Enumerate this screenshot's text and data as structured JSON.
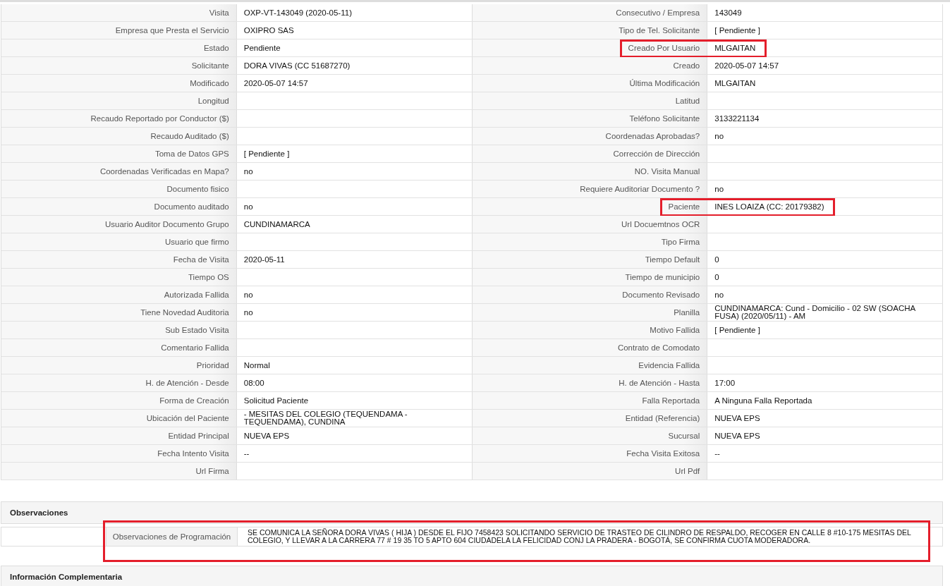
{
  "details": {
    "rows": [
      {
        "left": {
          "label": "Visita",
          "value": "OXP-VT-143049 (2020-05-11)",
          "highlighted": false
        },
        "right": {
          "label": "Consecutivo / Empresa",
          "value": "143049",
          "highlighted": false
        }
      },
      {
        "left": {
          "label": "Empresa que Presta el Servicio",
          "value": "OXIPRO SAS",
          "highlighted": false
        },
        "right": {
          "label": "Tipo de Tel. Solicitante",
          "value": "[ Pendiente ]",
          "highlighted": false
        }
      },
      {
        "left": {
          "label": "Estado",
          "value": "Pendiente",
          "highlighted": false
        },
        "right": {
          "label": "Creado Por Usuario",
          "value": "MLGAITAN",
          "highlighted": true
        }
      },
      {
        "left": {
          "label": "Solicitante",
          "value": "DORA VIVAS (CC 51687270)",
          "highlighted": false
        },
        "right": {
          "label": "Creado",
          "value": "2020-05-07 14:57",
          "highlighted": false
        }
      },
      {
        "left": {
          "label": "Modificado",
          "value": "2020-05-07 14:57",
          "highlighted": false
        },
        "right": {
          "label": "Última Modificación",
          "value": "MLGAITAN",
          "highlighted": false
        }
      },
      {
        "left": {
          "label": "Longitud",
          "highlighted": false
        },
        "right": {
          "label": "Latitud",
          "highlighted": false
        }
      },
      {
        "left": {
          "label": "Recaudo Reportado por Conductor ($)",
          "highlighted": false
        },
        "right": {
          "label": "Teléfono Solicitante",
          "value": "3133221134",
          "highlighted": false
        }
      },
      {
        "left": {
          "label": "Recaudo Auditado ($)",
          "highlighted": false
        },
        "right": {
          "label": "Coordenadas Aprobadas?",
          "value": "no",
          "highlighted": false
        }
      },
      {
        "left": {
          "label": "Toma de Datos GPS",
          "value": "[ Pendiente ]",
          "highlighted": false
        },
        "right": {
          "label": "Corrección de Dirección",
          "highlighted": false
        }
      },
      {
        "left": {
          "label": "Coordenadas Verificadas en Mapa?",
          "value": "no",
          "highlighted": false
        },
        "right": {
          "label": "NO. Visita Manual",
          "highlighted": false
        }
      },
      {
        "left": {
          "label": "Documento fisico",
          "highlighted": false
        },
        "right": {
          "label": "Requiere Auditoriar Documento ?",
          "value": "no",
          "highlighted": false
        }
      },
      {
        "left": {
          "label": "Documento auditado",
          "value": "no",
          "highlighted": false
        },
        "right": {
          "label": "Paciente",
          "value": "INES LOAIZA (CC: 20179382)",
          "highlighted": true
        }
      },
      {
        "left": {
          "label": "Usuario Auditor Documento Grupo",
          "value": "CUNDINAMARCA",
          "highlighted": false
        },
        "right": {
          "label": "Url Docuemtnos OCR",
          "highlighted": false
        }
      },
      {
        "left": {
          "label": "Usuario que firmo",
          "highlighted": false
        },
        "right": {
          "label": "Tipo Firma",
          "highlighted": false
        }
      },
      {
        "left": {
          "label": "Fecha de Visita",
          "value": "2020-05-11",
          "highlighted": false
        },
        "right": {
          "label": "Tiempo Default",
          "value": "0",
          "highlighted": false
        }
      },
      {
        "left": {
          "label": "Tiempo OS",
          "highlighted": false
        },
        "right": {
          "label": "Tiempo de municipio",
          "value": "0",
          "highlighted": false
        }
      },
      {
        "left": {
          "label": "Autorizada Fallida",
          "value": "no",
          "highlighted": false
        },
        "right": {
          "label": "Documento Revisado",
          "value": "no",
          "highlighted": false
        }
      },
      {
        "left": {
          "label": "Tiene Novedad Auditoria",
          "value": "no",
          "highlighted": false
        },
        "right": {
          "label": "Planilla",
          "value": "CUNDINAMARCA: Cund - Domicilio - 02 SW (SOACHA FUSA) (2020/05/11) - AM",
          "highlighted": false
        }
      },
      {
        "left": {
          "label": "Sub Estado Visita",
          "highlighted": false
        },
        "right": {
          "label": "Motivo Fallida",
          "value": "[ Pendiente ]",
          "highlighted": false
        }
      },
      {
        "left": {
          "label": "Comentario Fallida",
          "highlighted": false
        },
        "right": {
          "label": "Contrato de Comodato",
          "highlighted": false
        }
      },
      {
        "left": {
          "label": "Prioridad",
          "value": "Normal",
          "highlighted": false
        },
        "right": {
          "label": "Evidencia Fallida",
          "highlighted": false
        }
      },
      {
        "left": {
          "label": "H. de Atención - Desde",
          "value": "08:00",
          "highlighted": false
        },
        "right": {
          "label": "H. de Atención - Hasta",
          "value": "17:00",
          "highlighted": false
        }
      },
      {
        "left": {
          "label": "Forma de Creación",
          "value": "Solicitud Paciente",
          "highlighted": false
        },
        "right": {
          "label": "Falla Reportada",
          "value": "A Ninguna Falla Reportada",
          "highlighted": false
        }
      },
      {
        "left": {
          "label": "Ubicación del Paciente",
          "value": "- MESITAS DEL COLEGIO (TEQUENDAMA - TEQUENDAMA), CUNDINA",
          "highlighted": false
        },
        "right": {
          "label": "Entidad (Referencia)",
          "value": "NUEVA EPS",
          "highlighted": false
        }
      },
      {
        "left": {
          "label": "Entidad Principal",
          "value": "NUEVA EPS",
          "highlighted": false
        },
        "right": {
          "label": "Sucursal",
          "value": "NUEVA EPS",
          "highlighted": false
        }
      },
      {
        "left": {
          "label": "Fecha Intento Visita",
          "value": "--",
          "highlighted": false
        },
        "right": {
          "label": "Fecha Visita Exitosa",
          "value": "--",
          "highlighted": false
        }
      },
      {
        "left": {
          "label": "Url Firma",
          "highlighted": false
        },
        "right": {
          "label": "Url Pdf",
          "highlighted": false
        }
      }
    ]
  },
  "observaciones": {
    "title": "Observaciones",
    "rows": [
      {
        "label": "Observaciones de Programación",
        "value": "SE COMUNICA LA SEÑORA DORA VIVAS ( HIJA ) DESDE EL FIJO 7458423 SOLICITANDO SERVICIO DE TRASTEO DE CILINDRO DE RESPALDO, RECOGER EN CALLE 8 #10-175 MESITAS DEL COLEGIO, Y LLEVAR A LA CARRERA 77 # 19 35 TO 5 APTO 604 CIUDADELA LA FELICIDAD CONJ LA PRADERA - BOGOTÁ, SE CONFIRMA CUOTA MODERADORA.",
        "highlighted": true
      }
    ]
  },
  "informacion_complementaria": {
    "title": "Información Complementaria"
  }
}
